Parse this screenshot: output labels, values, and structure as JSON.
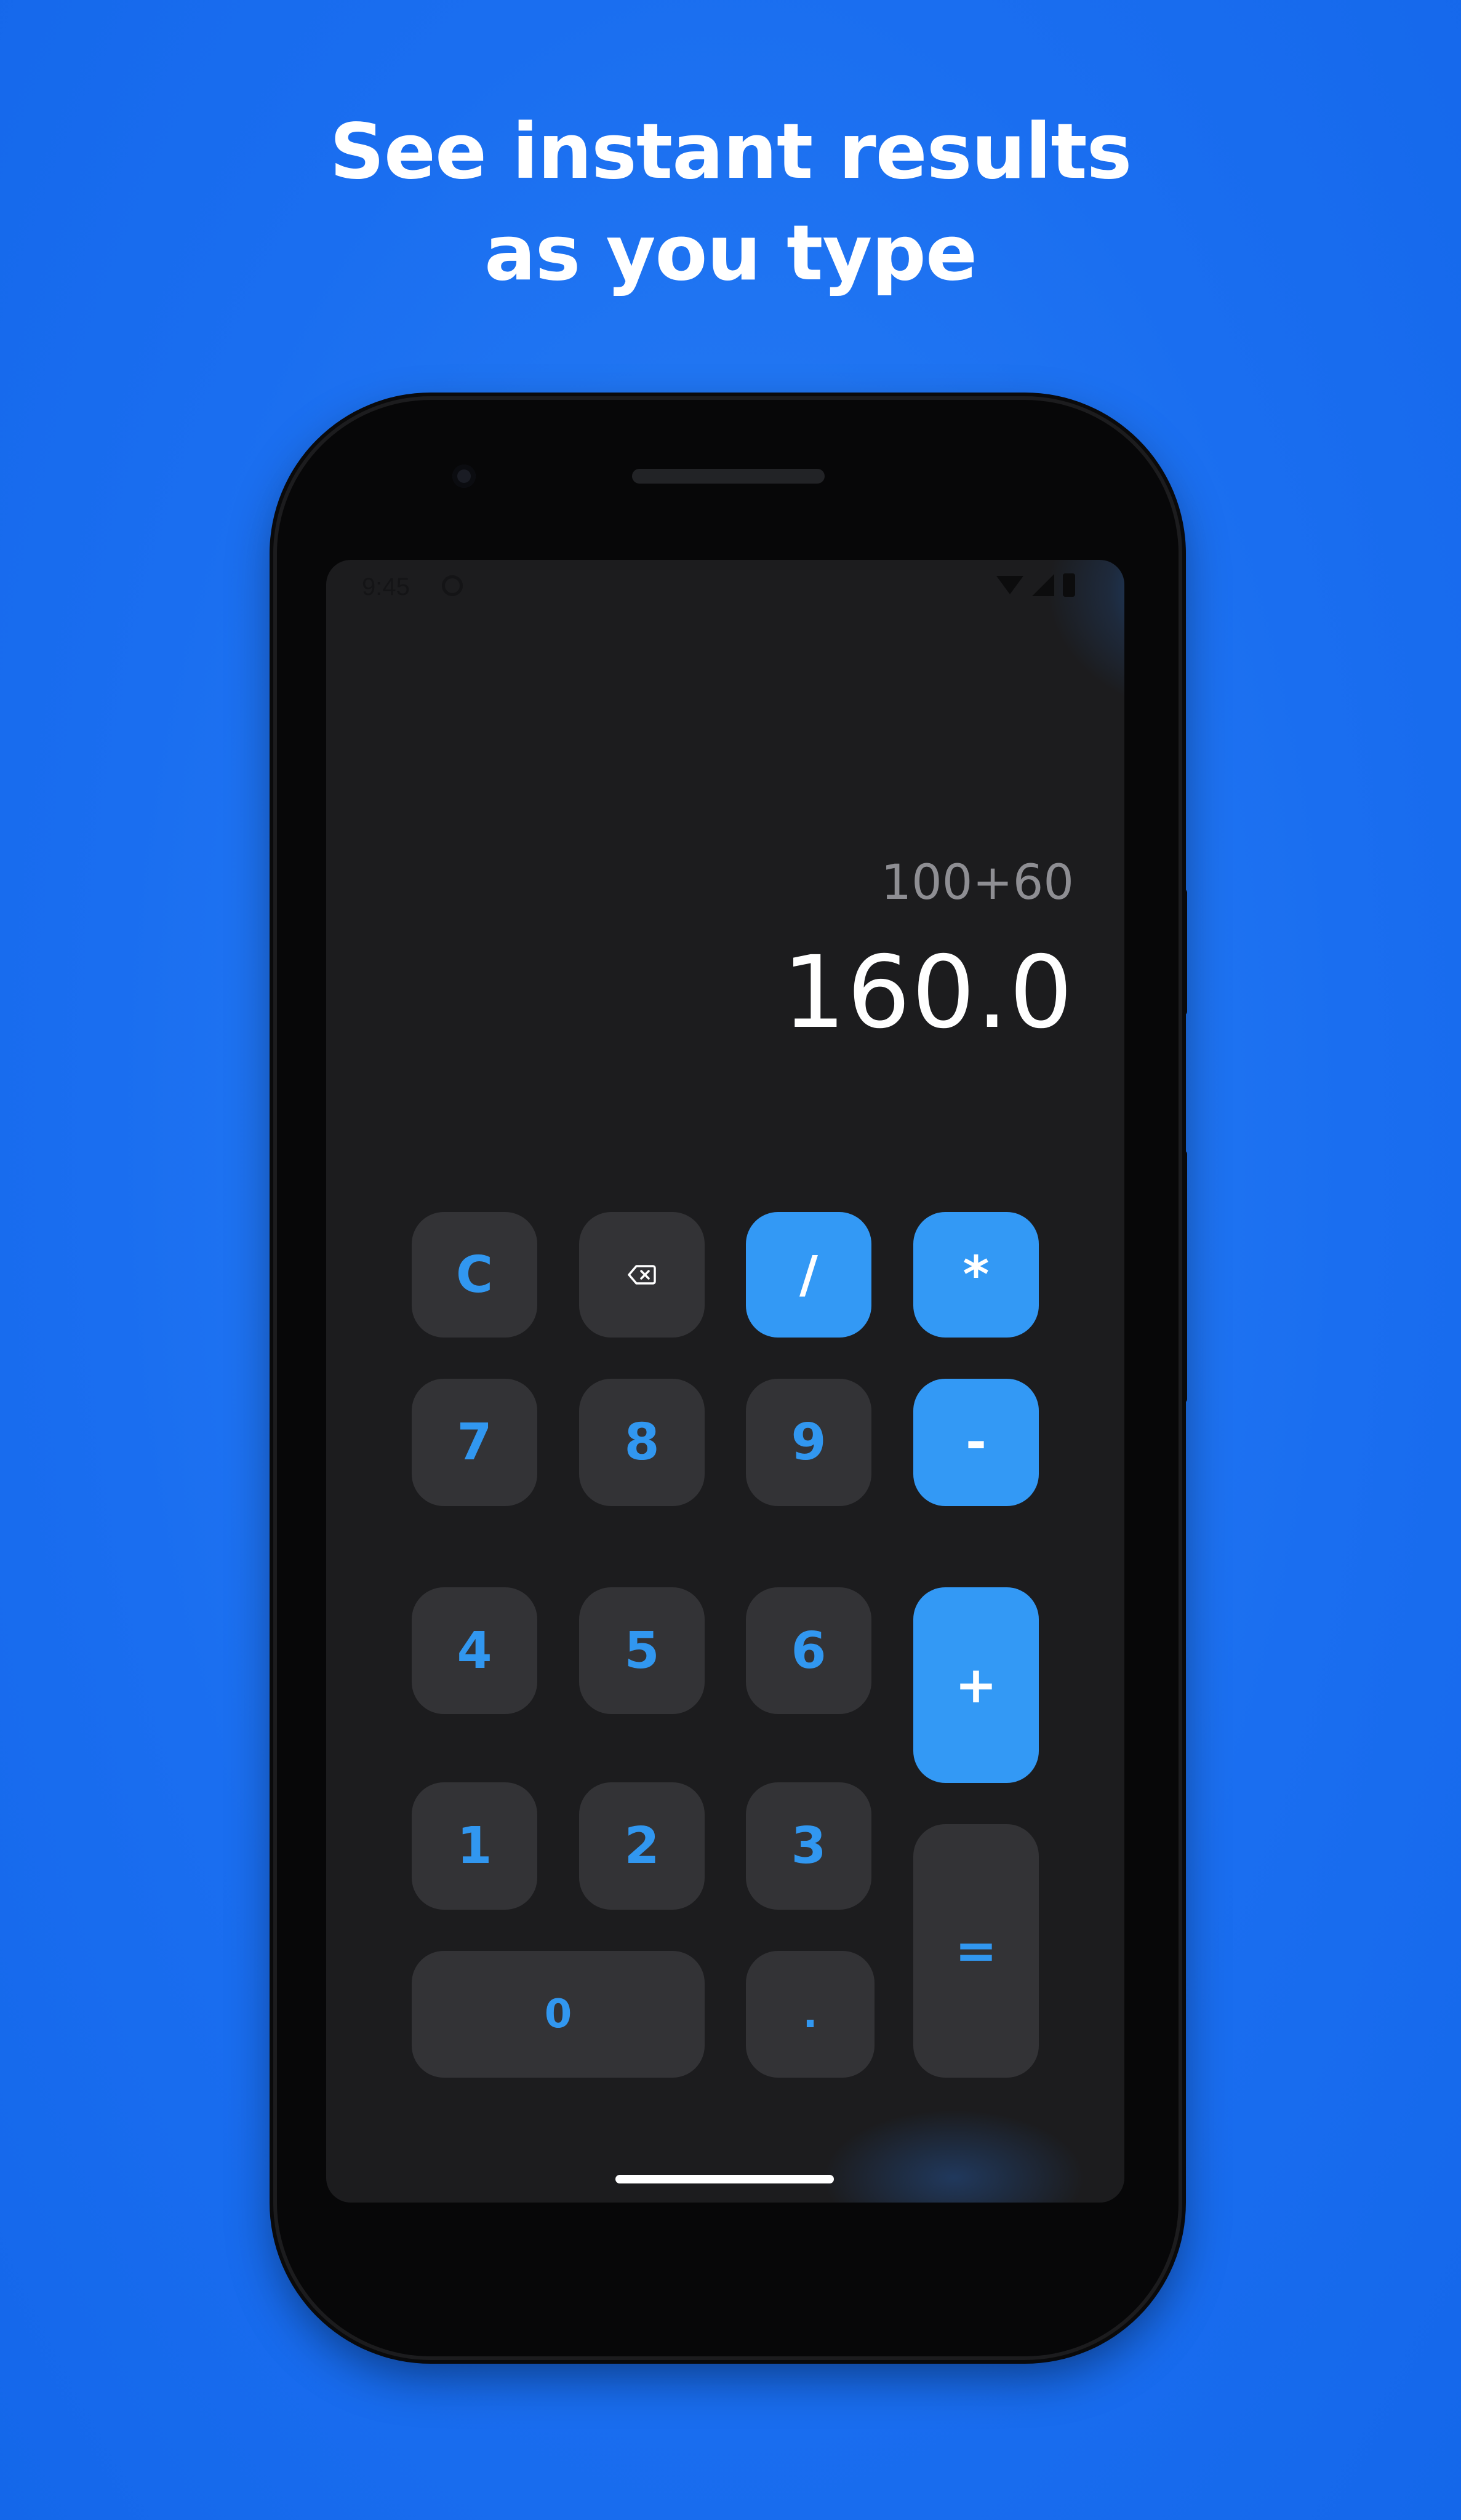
{
  "headline": {
    "line1": "See instant results",
    "line2": "as you type"
  },
  "status_bar": {
    "time": "9:45"
  },
  "display": {
    "expression": "100+60",
    "result": "160.0"
  },
  "keypad": {
    "clear": "C",
    "backspace_icon": "backspace-icon",
    "divide": "/",
    "multiply": "*",
    "seven": "7",
    "eight": "8",
    "nine": "9",
    "minus": "-",
    "four": "4",
    "five": "5",
    "six": "6",
    "plus": "+",
    "one": "1",
    "two": "2",
    "three": "3",
    "equals": "=",
    "zero": "0",
    "decimal": "."
  },
  "colors": {
    "background": "#1a6ef0",
    "accent": "#3399f5",
    "key_text": "#3197f0",
    "key_bg": "#333336",
    "screen_bg": "#1c1c1e"
  }
}
